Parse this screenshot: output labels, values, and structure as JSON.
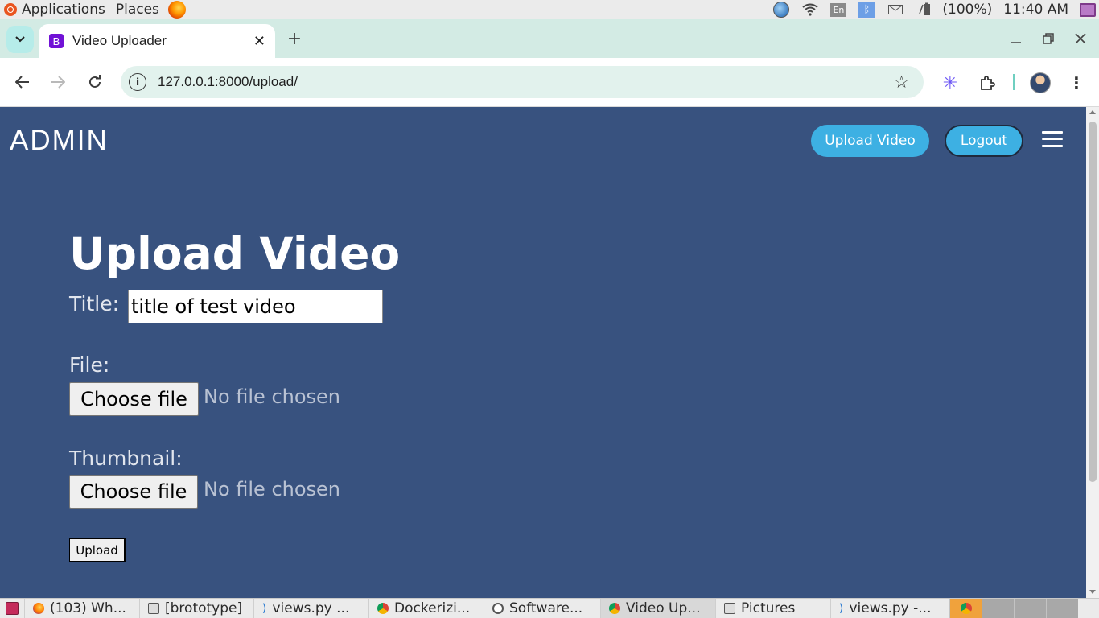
{
  "os_panel": {
    "applications_label": "Applications",
    "places_label": "Places",
    "language": "En",
    "battery": "(100%)",
    "clock": "11:40 AM"
  },
  "browser": {
    "tab": {
      "favicon_letter": "B",
      "title": "Video Uploader"
    },
    "url": "127.0.0.1:8000/upload/"
  },
  "page": {
    "brand": "ADMIN",
    "nav": {
      "upload_video": "Upload Video",
      "logout": "Logout"
    },
    "heading": "Upload Video",
    "form": {
      "title_label": "Title:",
      "title_value": "title of test video",
      "file_label": "File:",
      "thumbnail_label": "Thumbnail:",
      "choose_file": "Choose file",
      "no_file_chosen": "No file chosen",
      "upload_button": "Upload"
    },
    "colors": {
      "background": "#38527f",
      "accent": "#3db0e3"
    }
  },
  "taskbar": {
    "tasks": [
      {
        "label": "(103) Wh...",
        "icon": "firefox-icon"
      },
      {
        "label": "[brototype]",
        "icon": "terminal-icon"
      },
      {
        "label": "views.py ...",
        "icon": "vscode-icon"
      },
      {
        "label": "Dockerizi...",
        "icon": "chrome-icon"
      },
      {
        "label": "Software...",
        "icon": "software-icon"
      },
      {
        "label": "Video Up...",
        "icon": "chrome-icon"
      },
      {
        "label": "Pictures",
        "icon": "folder-icon"
      },
      {
        "label": "views.py -...",
        "icon": "vscode-icon"
      }
    ]
  }
}
